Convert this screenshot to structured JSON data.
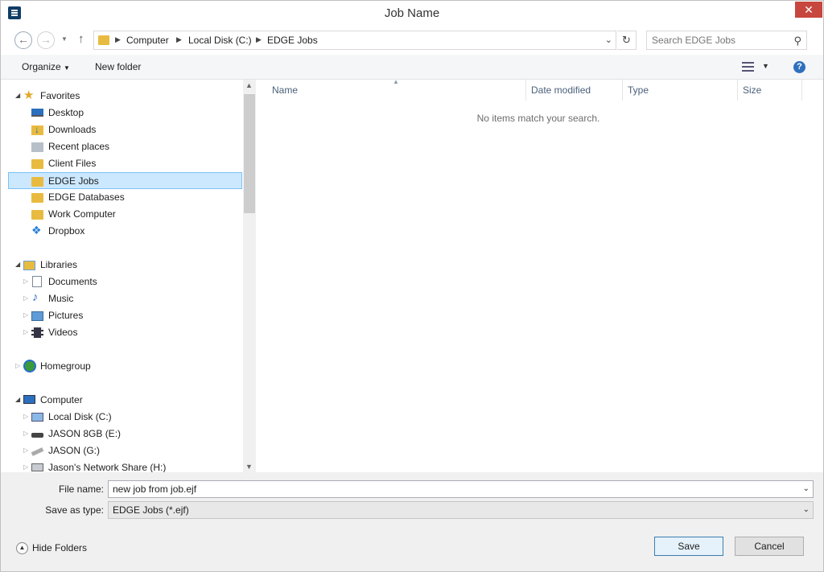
{
  "window": {
    "title": "Job Name",
    "close_glyph": "✕"
  },
  "address": {
    "crumbs": [
      "Computer",
      "Local Disk (C:)",
      "EDGE Jobs"
    ],
    "search_placeholder": "Search EDGE Jobs"
  },
  "toolbar": {
    "organize_label": "Organize",
    "new_folder_label": "New folder",
    "help_glyph": "?"
  },
  "nav": {
    "favorites": {
      "label": "Favorites",
      "items": [
        "Desktop",
        "Downloads",
        "Recent places",
        "Client Files",
        "EDGE Jobs",
        "EDGE Databases",
        "Work Computer",
        "Dropbox"
      ],
      "selected": "EDGE Jobs"
    },
    "libraries": {
      "label": "Libraries",
      "items": [
        "Documents",
        "Music",
        "Pictures",
        "Videos"
      ]
    },
    "homegroup": {
      "label": "Homegroup"
    },
    "computer": {
      "label": "Computer",
      "items": [
        "Local Disk (C:)",
        "JASON 8GB (E:)",
        "JASON (G:)",
        "Jason's Network Share (H:)"
      ]
    }
  },
  "list": {
    "columns": [
      "Name",
      "Date modified",
      "Type",
      "Size"
    ],
    "empty_message": "No items match your search."
  },
  "form": {
    "file_name_label": "File name:",
    "file_name_value": "new job from job.ejf",
    "save_type_label": "Save as type:",
    "save_type_value": "EDGE Jobs (*.ejf)"
  },
  "footer": {
    "hide_folders_label": "Hide Folders",
    "save_label": "Save",
    "cancel_label": "Cancel"
  },
  "colors": {
    "selection_bg": "#cce8ff",
    "selection_border": "#7ac1f5",
    "close_red": "#c7463d",
    "folder_yellow": "#e8bb40"
  }
}
